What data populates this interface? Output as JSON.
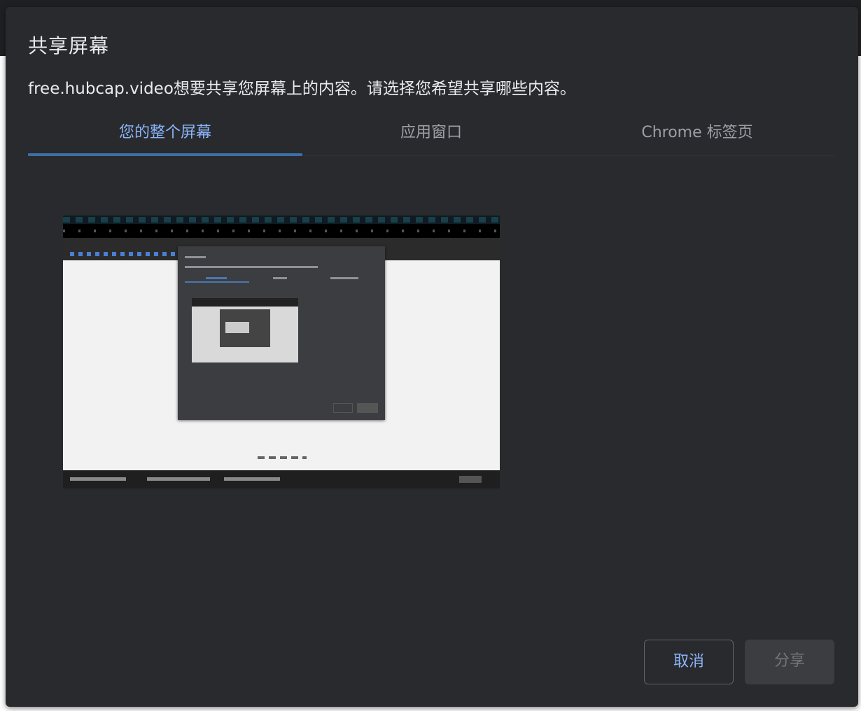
{
  "dialog": {
    "title": "共享屏幕",
    "description": "free.hubcap.video想要共享您屏幕上的内容。请选择您希望共享哪些内容。"
  },
  "tabs": [
    {
      "label": "您的整个屏幕",
      "active": true
    },
    {
      "label": "应用窗口",
      "active": false
    },
    {
      "label": "Chrome 标签页",
      "active": false
    }
  ],
  "buttons": {
    "cancel": "取消",
    "share": "分享"
  },
  "colors": {
    "dialog_bg": "#292a2d",
    "accent": "#8ab4f8",
    "tab_underline": "#3c6ea8",
    "muted_text": "#9aa0a6"
  }
}
